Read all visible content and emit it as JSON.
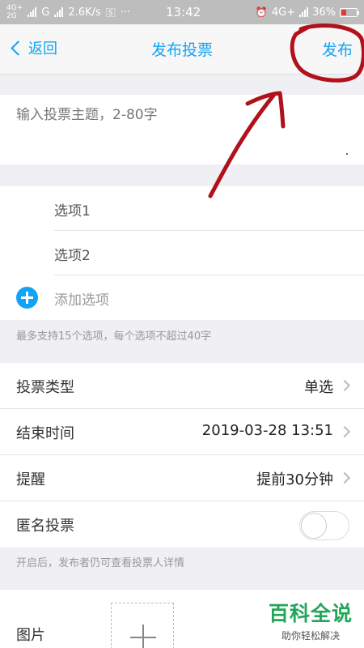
{
  "status_bar": {
    "net_top": "4G+",
    "net_bottom": "2G",
    "carrier_g": "G",
    "speed": "2.6K/s",
    "dots": "···",
    "time": "13:42",
    "net_right": "4G+",
    "battery": "36%",
    "battery_level": 0.36,
    "battery_color": "#e53935"
  },
  "navbar": {
    "back_label": "返回",
    "title": "发布投票",
    "publish_label": "发布"
  },
  "topic": {
    "placeholder": "输入投票主题，2-80字"
  },
  "options": {
    "items": [
      "选项1",
      "选项2"
    ],
    "add_label": "添加选项",
    "hint": "最多支持15个选项，每个选项不超过40字"
  },
  "settings": {
    "vote_type_label": "投票类型",
    "vote_type_value": "单选",
    "end_time_label": "结束时间",
    "end_time_value": "2019-03-28 13:51",
    "remind_label": "提醒",
    "remind_value": "提前30分钟",
    "anonymous_label": "匿名投票",
    "anonymous_on": false,
    "anonymous_hint": "开启后，发布者仍可查看投票人详情"
  },
  "image": {
    "label": "图片"
  },
  "watermark": {
    "title": "百科全说",
    "subtitle": "助你轻松解决"
  },
  "colors": {
    "accent": "#12a4f4",
    "annotation": "#b0111a",
    "watermark": "#23a55a"
  }
}
